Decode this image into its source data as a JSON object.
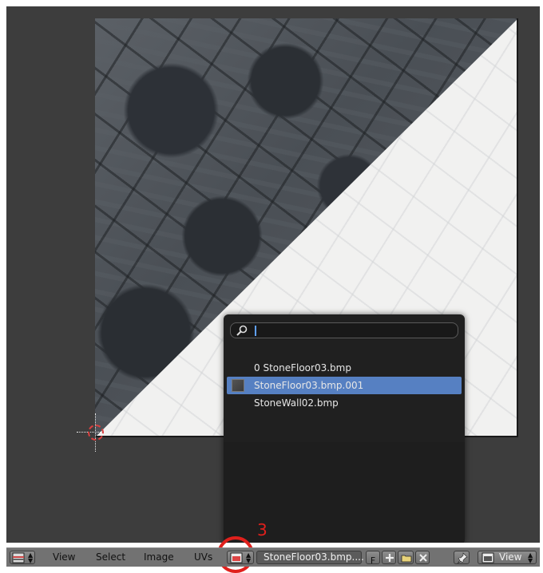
{
  "popup": {
    "search_value": "",
    "items": [
      {
        "label": "0 StoneFloor03.bmp",
        "selected": false,
        "has_thumb": false
      },
      {
        "label": "StoneFloor03.bmp.001",
        "selected": true,
        "has_thumb": true
      },
      {
        "label": "StoneWall02.bmp",
        "selected": false,
        "has_thumb": false
      }
    ]
  },
  "annotation": {
    "number": "3",
    "color": "#e0201c"
  },
  "header": {
    "menus": {
      "view": "View",
      "select": "Select",
      "image": "Image",
      "uvs": "UVs"
    },
    "image_name": "StoneFloor03.bmp....",
    "fake_user_label": "F",
    "view_mode_label": "View"
  },
  "colors": {
    "selection": "#5680c2",
    "viewport_bg": "#3d3d3d",
    "header_bg": "#727272"
  }
}
